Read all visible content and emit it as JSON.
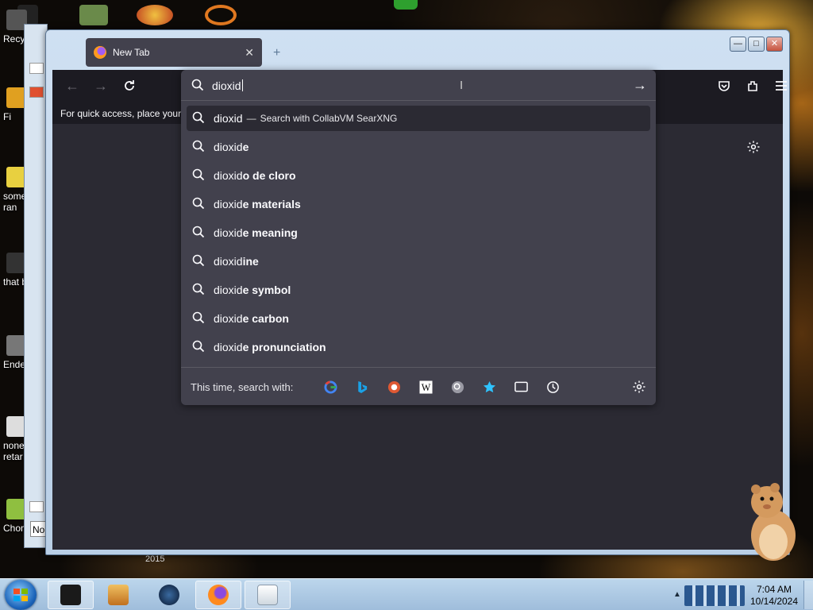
{
  "desktop": {
    "icons": [
      {
        "label": "Recy",
        "color": "#555555"
      },
      {
        "label": "Fi",
        "color": "#e0a020"
      },
      {
        "label": "some\nran",
        "color": "#e8d040"
      },
      {
        "label": "that b",
        "color": "#333333"
      },
      {
        "label": "Ende",
        "color": "#777777"
      },
      {
        "label": "none\nretar",
        "color": "#dddddd"
      },
      {
        "label": "ChomikB",
        "color": "#8fbf40"
      }
    ],
    "label_2015": "2015"
  },
  "browser": {
    "tab_title": "New Tab",
    "tab_close": "✕",
    "bookmarks_text": "For quick access, place your b",
    "url_value": "dioxid",
    "suggestions": [
      {
        "base": "dioxid",
        "rest": "",
        "sep": "—",
        "engine": "Search with CollabVM SearXNG",
        "active": true
      },
      {
        "base": "dioxid",
        "rest": "e"
      },
      {
        "base": "dioxid",
        "rest": "o de cloro"
      },
      {
        "base": "dioxid",
        "rest": "e materials"
      },
      {
        "base": "dioxid",
        "rest": "e meaning"
      },
      {
        "base": "dioxid",
        "rest": "ine"
      },
      {
        "base": "dioxid",
        "rest": "e symbol"
      },
      {
        "base": "dioxid",
        "rest": "e carbon"
      },
      {
        "base": "dioxid",
        "rest": "e pronunciation"
      }
    ],
    "footer_label": "This time, search with:",
    "search_engines": [
      {
        "name": "google-icon",
        "color": "#4285f4"
      },
      {
        "name": "bing-icon",
        "color": "#1aa1e6"
      },
      {
        "name": "duckduckgo-icon",
        "color": "#de5833"
      },
      {
        "name": "wikipedia-icon",
        "color": "#ffffff"
      },
      {
        "name": "searxng-icon",
        "color": "#9a9aa4"
      },
      {
        "name": "bookmarks-star-icon",
        "color": "#2fc3ff"
      },
      {
        "name": "tabs-icon",
        "color": "#fbfbfe"
      },
      {
        "name": "history-icon",
        "color": "#fbfbfe"
      }
    ]
  },
  "taskbar": {
    "time": "7:04 AM",
    "date": "10/14/2024"
  }
}
